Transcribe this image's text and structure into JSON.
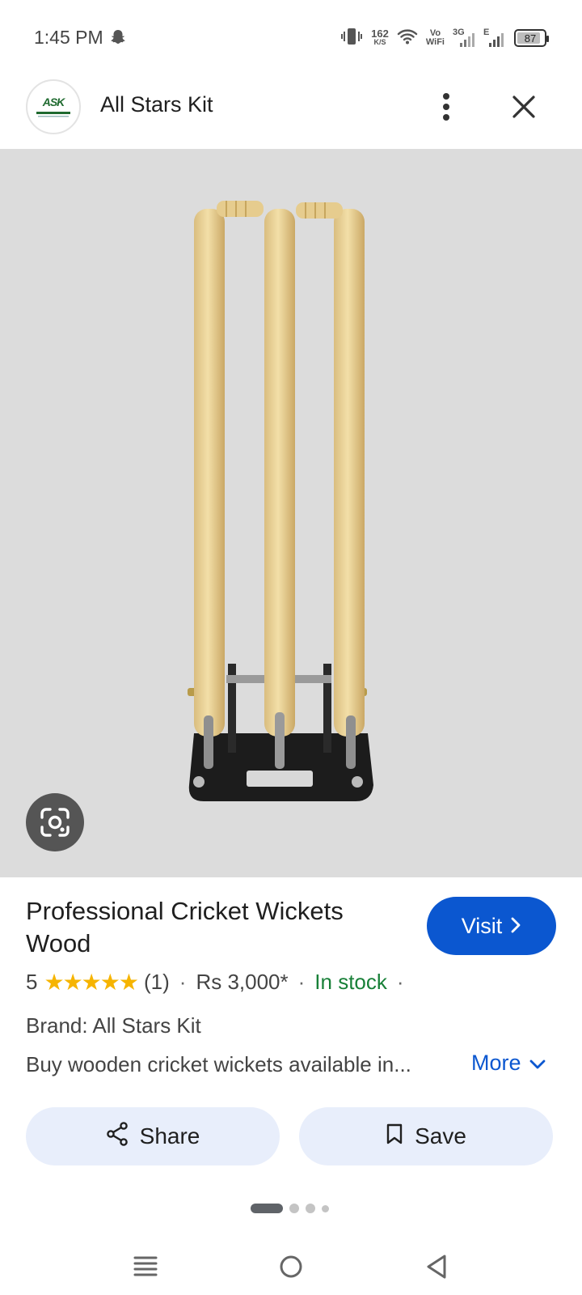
{
  "status_bar": {
    "time": "1:45 PM",
    "net_speed_value": "162",
    "net_speed_unit": "K/S",
    "volte_top": "Vo",
    "volte_bottom": "WiFi",
    "network_3g": "3G",
    "network_e": "E",
    "battery_level": "87",
    "battery_fraction": 0.87
  },
  "header": {
    "site_name": "All Stars Kit",
    "logo_text": "ASK"
  },
  "product": {
    "title": "Professional Cricket Wickets Wood",
    "rating_value": "5",
    "stars": "★★★★★",
    "review_count": "(1)",
    "price": "Rs 3,000*",
    "stock_status": "In stock",
    "separator": "·",
    "brand": "Brand: All Stars Kit",
    "description": "Buy wooden cricket wickets available in..."
  },
  "actions": {
    "visit_label": "Visit",
    "more_label": "More",
    "share_label": "Share",
    "save_label": "Save"
  },
  "colors": {
    "accent": "#0b57d0",
    "in_stock": "#188038",
    "star": "#f6b400",
    "image_bg": "#dcdcdc",
    "action_bg": "#e8eefb"
  },
  "icons": {
    "snapchat": "snapchat-ghost-icon",
    "vibrate": "vibrate-icon",
    "wifi": "wifi-icon",
    "signal": "signal-icon",
    "battery": "battery-icon",
    "more": "more-vert-icon",
    "close": "close-icon",
    "lens": "google-lens-icon",
    "visit": "chevron-right-icon",
    "expand": "chevron-down-icon",
    "share": "share-icon",
    "save": "bookmark-icon",
    "nav_menu": "menu-icon",
    "nav_home": "home-circle-icon",
    "nav_back": "back-triangle-icon"
  },
  "pager": {
    "count": 4,
    "active_index": 0
  }
}
